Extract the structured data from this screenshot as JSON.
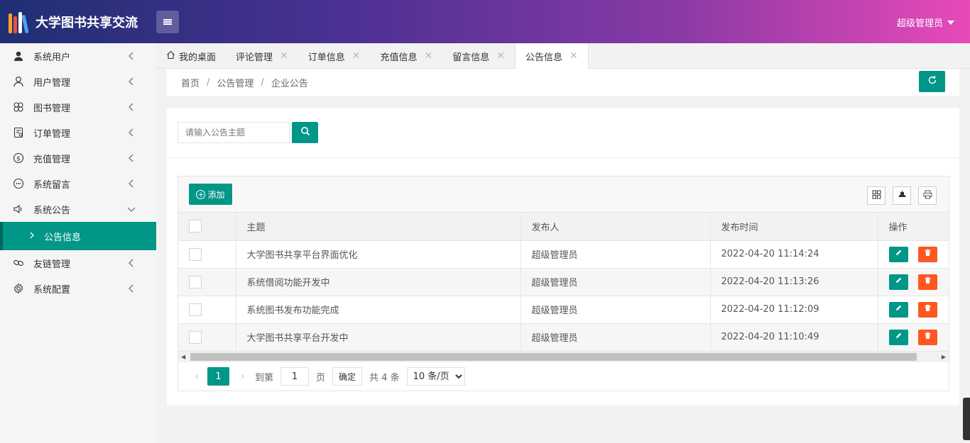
{
  "header": {
    "title": "大学图书共享交流",
    "user": "超级管理员"
  },
  "sidebar": {
    "items": [
      {
        "label": "系统用户",
        "icon": "user-filled-icon"
      },
      {
        "label": "用户管理",
        "icon": "user-outline-icon"
      },
      {
        "label": "图书管理",
        "icon": "flower-icon"
      },
      {
        "label": "订单管理",
        "icon": "order-icon"
      },
      {
        "label": "充值管理",
        "icon": "dollar-icon"
      },
      {
        "label": "系统留言",
        "icon": "message-icon"
      },
      {
        "label": "系统公告",
        "icon": "speaker-icon"
      },
      {
        "label": "友链管理",
        "icon": "link-icon"
      },
      {
        "label": "系统配置",
        "icon": "gear-icon"
      }
    ],
    "active_sub": "公告信息"
  },
  "tabs": [
    {
      "label": "我的桌面"
    },
    {
      "label": "评论管理"
    },
    {
      "label": "订单信息"
    },
    {
      "label": "充值信息"
    },
    {
      "label": "留言信息"
    },
    {
      "label": "公告信息"
    }
  ],
  "breadcrumb": [
    "首页",
    "公告管理",
    "企业公告"
  ],
  "search": {
    "placeholder": "请输入公告主题",
    "value": ""
  },
  "toolbar": {
    "add_label": "添加"
  },
  "table": {
    "columns": [
      "主题",
      "发布人",
      "发布时间",
      "操作"
    ],
    "rows": [
      {
        "title": "大学图书共享平台界面优化",
        "publisher": "超级管理员",
        "time": "2022-04-20 11:14:24"
      },
      {
        "title": "系统借阅功能开发中",
        "publisher": "超级管理员",
        "time": "2022-04-20 11:13:26"
      },
      {
        "title": "系统图书发布功能完成",
        "publisher": "超级管理员",
        "time": "2022-04-20 11:12:09"
      },
      {
        "title": "大学图书共享平台开发中",
        "publisher": "超级管理员",
        "time": "2022-04-20 11:10:49"
      }
    ]
  },
  "pager": {
    "current": "1",
    "goto_label": "到第",
    "page_input": "1",
    "page_unit": "页",
    "confirm": "确定",
    "total": "共 4 条",
    "page_size": "10 条/页"
  },
  "colors": {
    "primary": "#009688",
    "danger": "#ff5722"
  }
}
